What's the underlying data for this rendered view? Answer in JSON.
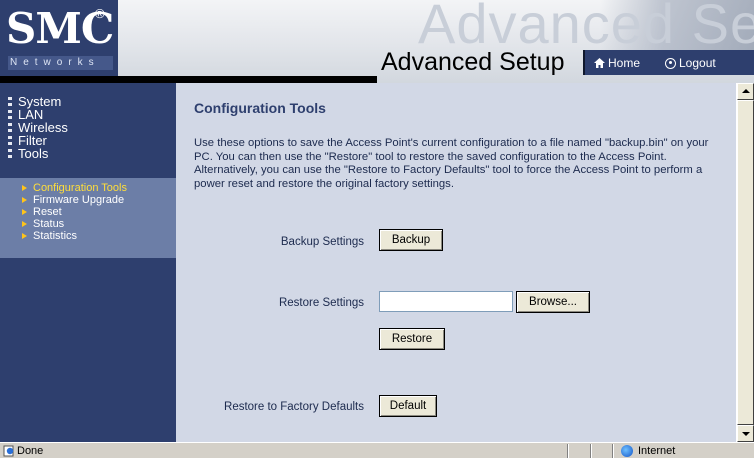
{
  "header": {
    "brand": "SMC",
    "brand_reg": "®",
    "brand_sub": "Networks",
    "watermark_title": "Advanced Setup",
    "title": "Advanced Setup",
    "home_label": "Home",
    "logout_label": "Logout"
  },
  "sidebar": {
    "main_items": [
      {
        "label": "System",
        "icon": "bullet-icon"
      },
      {
        "label": "LAN",
        "icon": "bullet-icon"
      },
      {
        "label": "Wireless",
        "icon": "bullet-icon"
      },
      {
        "label": "Filter",
        "icon": "bullet-icon"
      },
      {
        "label": "Tools",
        "icon": "bullet-icon"
      }
    ],
    "sub_items": [
      {
        "label": "Configuration Tools",
        "active": true
      },
      {
        "label": "Firmware Upgrade",
        "active": false
      },
      {
        "label": "Reset",
        "active": false
      },
      {
        "label": "Status",
        "active": false
      },
      {
        "label": "Statistics",
        "active": false
      }
    ]
  },
  "content": {
    "title": "Configuration Tools",
    "description": "Use these options to save the Access Point's current configuration to a file named \"backup.bin\" on your PC. You can then use the \"Restore\" tool to restore the saved configuration to the Access Point. Alternatively, you can use the \"Restore to Factory Defaults\" tool to force the Access Point to perform a power reset and restore the original factory settings.",
    "backup": {
      "label": "Backup Settings",
      "button": "Backup"
    },
    "restore": {
      "label": "Restore Settings",
      "file_value": "",
      "browse_button": "Browse...",
      "button": "Restore"
    },
    "factory": {
      "label": "Restore to Factory Defaults",
      "button": "Default"
    }
  },
  "statusbar": {
    "status": "Done",
    "zone": "Internet"
  },
  "colors": {
    "sidebar_bg": "#2e3f6e",
    "submenu_bg": "#6c7ea7",
    "content_bg": "#d2d8e6",
    "title_color": "#2e3f6e",
    "active_item": "#ffde3a"
  }
}
